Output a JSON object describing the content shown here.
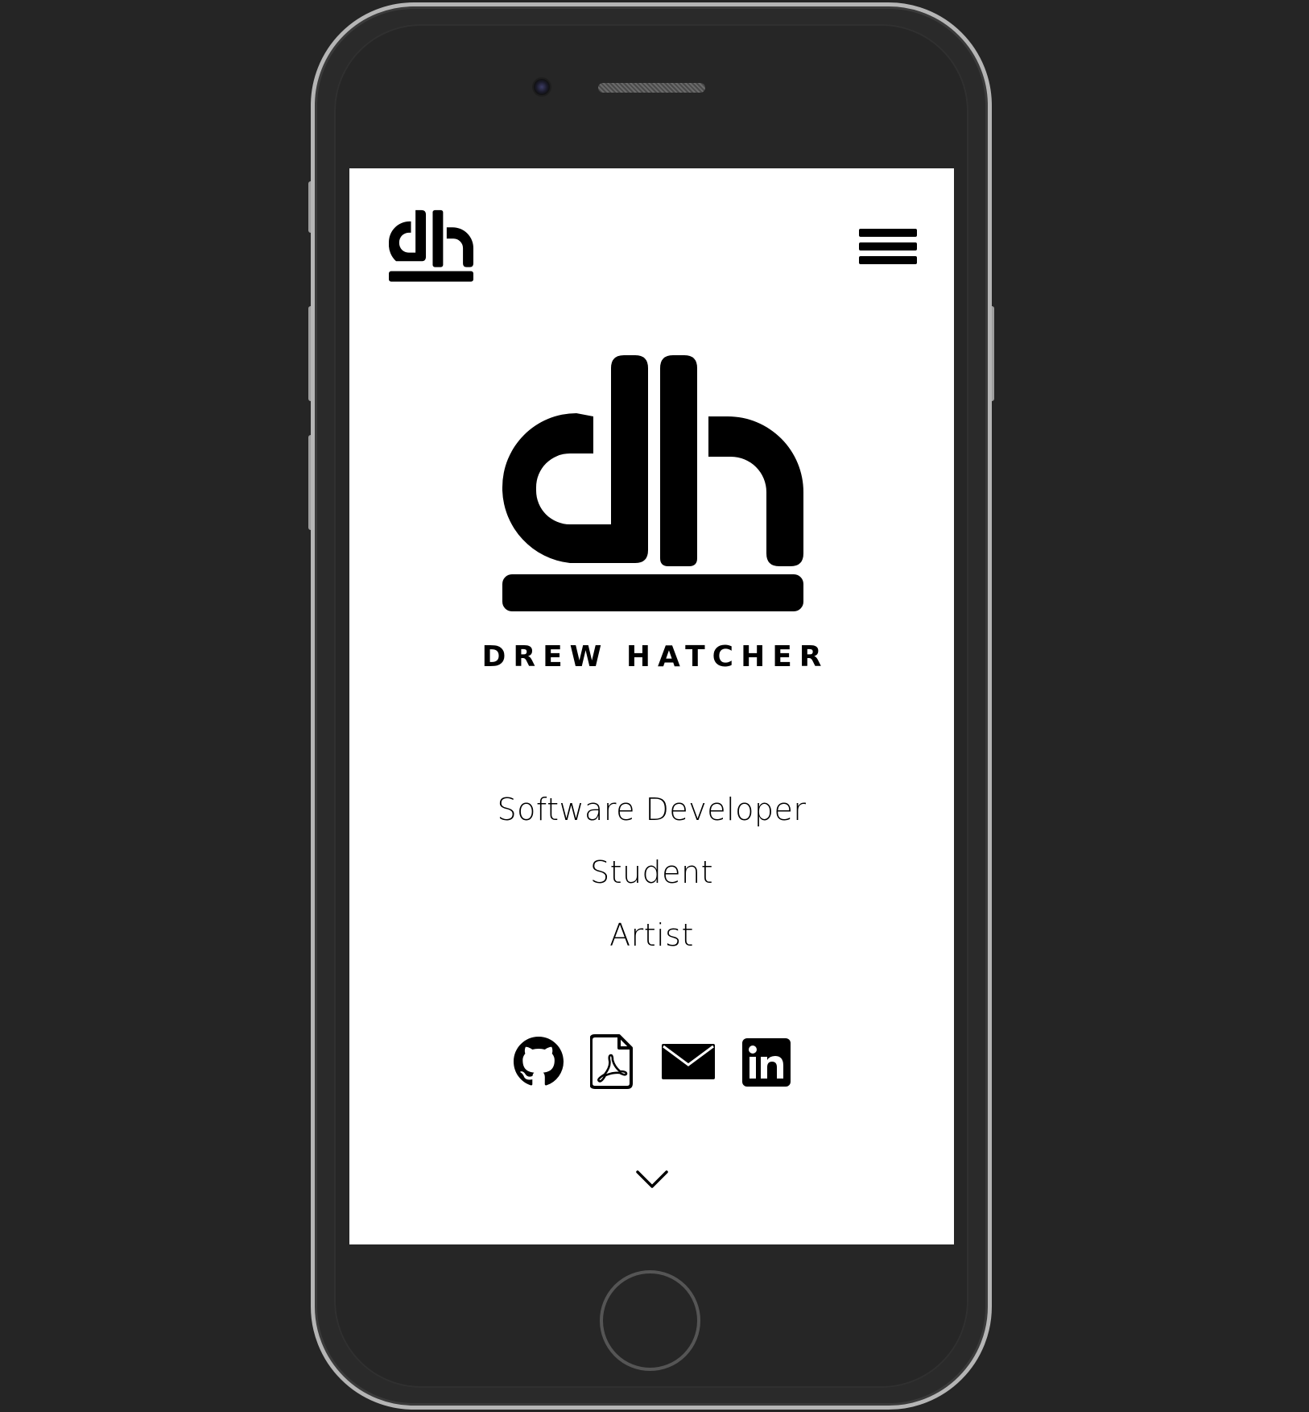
{
  "device": {
    "type": "phone-mockup",
    "frame_color": "#b5b5b5",
    "body_color": "#262626",
    "background_color": "#252525"
  },
  "header": {
    "logo_icon": "dh-logo-icon",
    "menu_icon": "hamburger-menu-icon"
  },
  "hero": {
    "logo_icon": "dh-logo-icon",
    "name": "DREW HATCHER"
  },
  "roles": [
    "Software Developer",
    "Student",
    "Artist"
  ],
  "socials": [
    {
      "icon": "github-icon"
    },
    {
      "icon": "pdf-resume-icon"
    },
    {
      "icon": "email-icon"
    },
    {
      "icon": "linkedin-icon"
    }
  ],
  "scroll_icon": "chevron-down-icon",
  "colors": {
    "text": "#000000",
    "screen_bg": "#ffffff"
  }
}
